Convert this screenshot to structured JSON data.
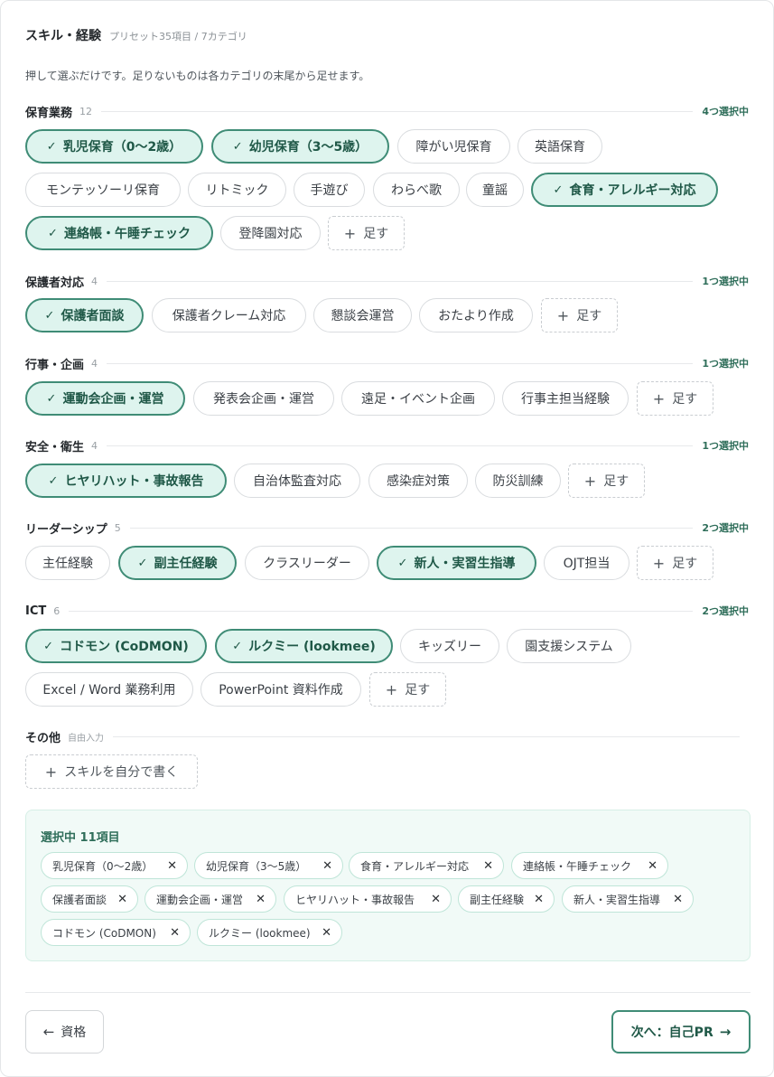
{
  "header": {
    "title": "スキル・経験",
    "subtitle": "プリセット35項目 / 7カテゴリ",
    "intro": "押して選ぶだけです。足りないものは各カテゴリの末尾から足せます。"
  },
  "add_label": "足す",
  "categories": [
    {
      "name": "保育業務",
      "count": "12",
      "selected_label": "4つ選択中",
      "chips": [
        {
          "label": "乳児保育（0〜2歳）",
          "selected": true
        },
        {
          "label": "幼児保育（3〜5歳）",
          "selected": true
        },
        {
          "label": "障がい児保育",
          "selected": false
        },
        {
          "label": "英語保育",
          "selected": false
        },
        {
          "label": "モンテッソーリ保育",
          "selected": false
        },
        {
          "label": "リトミック",
          "selected": false
        },
        {
          "label": "手遊び",
          "selected": false
        },
        {
          "label": "わらべ歌",
          "selected": false
        },
        {
          "label": "童謡",
          "selected": false
        },
        {
          "label": "食育・アレルギー対応",
          "selected": true
        },
        {
          "label": "連絡帳・午睡チェック",
          "selected": true
        },
        {
          "label": "登降園対応",
          "selected": false
        }
      ]
    },
    {
      "name": "保護者対応",
      "count": "4",
      "selected_label": "1つ選択中",
      "chips": [
        {
          "label": "保護者面談",
          "selected": true
        },
        {
          "label": "保護者クレーム対応",
          "selected": false
        },
        {
          "label": "懇談会運営",
          "selected": false
        },
        {
          "label": "おたより作成",
          "selected": false
        }
      ]
    },
    {
      "name": "行事・企画",
      "count": "4",
      "selected_label": "1つ選択中",
      "chips": [
        {
          "label": "運動会企画・運営",
          "selected": true
        },
        {
          "label": "発表会企画・運営",
          "selected": false
        },
        {
          "label": "遠足・イベント企画",
          "selected": false
        },
        {
          "label": "行事主担当経験",
          "selected": false
        }
      ]
    },
    {
      "name": "安全・衛生",
      "count": "4",
      "selected_label": "1つ選択中",
      "chips": [
        {
          "label": "ヒヤリハット・事故報告",
          "selected": true
        },
        {
          "label": "自治体監査対応",
          "selected": false
        },
        {
          "label": "感染症対策",
          "selected": false
        },
        {
          "label": "防災訓練",
          "selected": false
        }
      ]
    },
    {
      "name": "リーダーシップ",
      "count": "5",
      "selected_label": "2つ選択中",
      "chips": [
        {
          "label": "主任経験",
          "selected": false
        },
        {
          "label": "副主任経験",
          "selected": true
        },
        {
          "label": "クラスリーダー",
          "selected": false
        },
        {
          "label": "新人・実習生指導",
          "selected": true
        },
        {
          "label": "OJT担当",
          "selected": false
        }
      ]
    },
    {
      "name": "ICT",
      "count": "6",
      "selected_label": "2つ選択中",
      "chips": [
        {
          "label": "コドモン (CoDMON)",
          "selected": true
        },
        {
          "label": "ルクミー (lookmee)",
          "selected": true
        },
        {
          "label": "キッズリー",
          "selected": false
        },
        {
          "label": "園支援システム",
          "selected": false
        },
        {
          "label": "Excel / Word 業務利用",
          "selected": false
        },
        {
          "label": "PowerPoint 資料作成",
          "selected": false
        }
      ]
    }
  ],
  "other": {
    "name": "その他",
    "note": "自由入力",
    "button_label": "スキルを自分で書く"
  },
  "summary": {
    "title": "選択中 11項目",
    "tags": [
      "乳児保育（0〜2歳）",
      "幼児保育（3〜5歳）",
      "食育・アレルギー対応",
      "連絡帳・午睡チェック",
      "保護者面談",
      "運動会企画・運営",
      "ヒヤリハット・事故報告",
      "副主任経験",
      "新人・実習生指導",
      "コドモン (CoDMON)",
      "ルクミー (lookmee)"
    ]
  },
  "nav": {
    "back_label": "資格",
    "next_label": "次へ：自己PR"
  },
  "colors": {
    "accent": "#3f8c76",
    "accent_bg": "#def4ee",
    "summary_bg": "#f1faf7"
  }
}
